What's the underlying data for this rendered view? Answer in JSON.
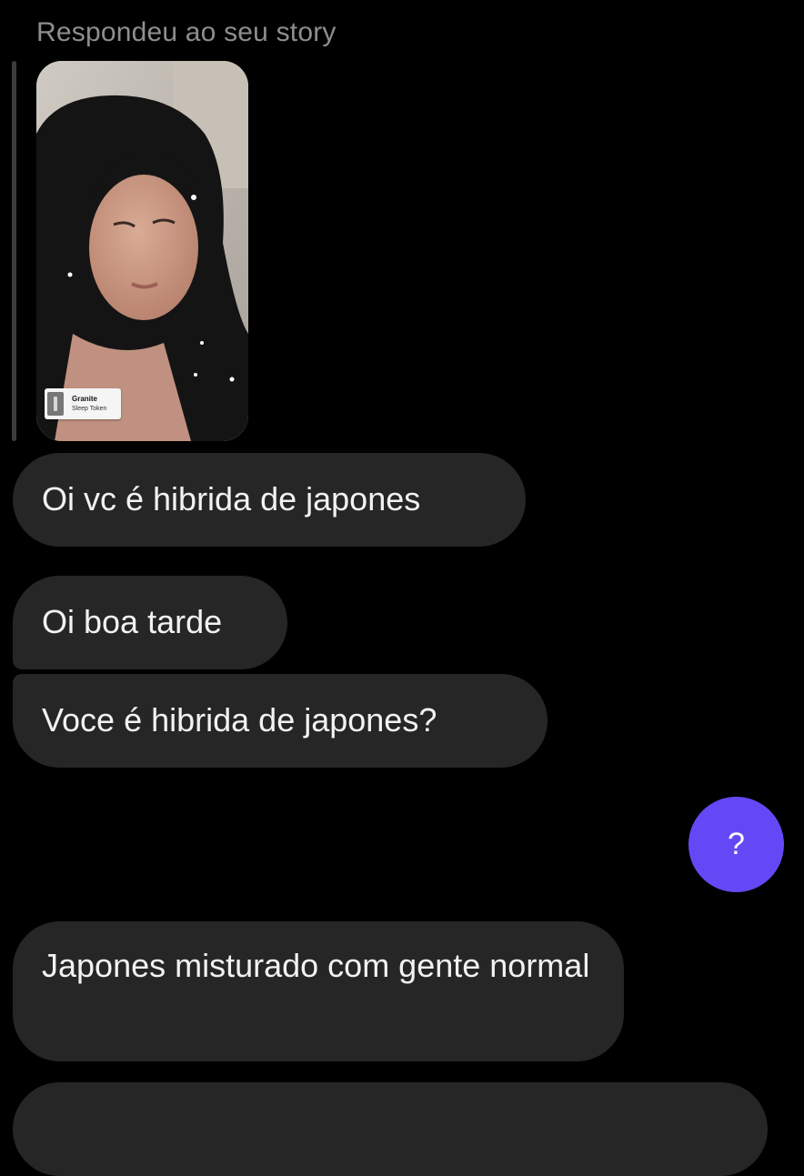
{
  "reply_header": {
    "label": "Respondeu ao seu story"
  },
  "story": {
    "music_sticker": {
      "title": "Granite",
      "artist": "Sleep Token"
    }
  },
  "messages": [
    {
      "direction": "received",
      "text": "Oi vc é hibrida de japones"
    },
    {
      "direction": "received",
      "text": "Oi boa tarde"
    },
    {
      "direction": "received",
      "text": "Voce é hibrida de japones?"
    },
    {
      "direction": "sent",
      "text": "?"
    },
    {
      "direction": "received",
      "text": "Japones misturado com gente normal"
    }
  ],
  "colors": {
    "background": "#000000",
    "received_bubble": "#262626",
    "sent_bubble": "#6548f5",
    "muted_text": "#8e8e8e"
  }
}
